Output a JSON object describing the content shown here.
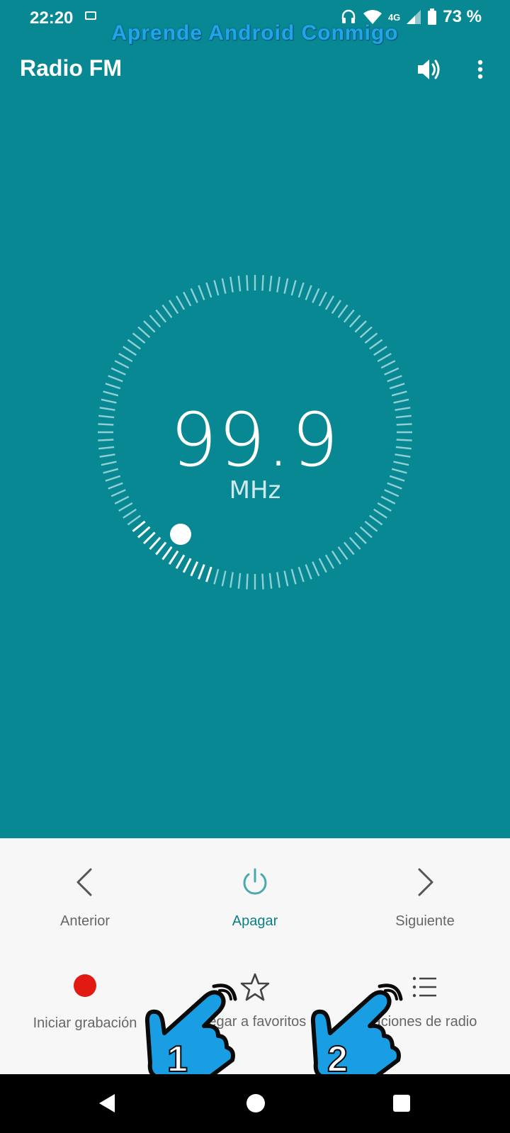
{
  "status_bar": {
    "time": "22:20",
    "network": "4G",
    "battery": "73 %",
    "icons": [
      "sim-icon",
      "headphones-icon",
      "wifi-icon",
      "signal-icon",
      "battery-icon"
    ]
  },
  "watermark": "Aprende Android Conmigo",
  "app_bar": {
    "title": "Radio FM",
    "icons": [
      "speaker-icon",
      "more-vert-icon"
    ]
  },
  "tuner": {
    "frequency": "99.9",
    "unit": "MHz"
  },
  "controls": {
    "row1": [
      {
        "label": "Anterior",
        "icon": "chevron-left-icon"
      },
      {
        "label": "Apagar",
        "icon": "power-icon"
      },
      {
        "label": "Siguiente",
        "icon": "chevron-right-icon"
      }
    ],
    "row2": [
      {
        "label": "Iniciar grabación",
        "icon": "record-icon"
      },
      {
        "label": "regar a favoritos",
        "icon": "star-icon"
      },
      {
        "label": "aciones de radio",
        "icon": "list-icon"
      }
    ]
  },
  "annotations": [
    "1",
    "2"
  ],
  "colors": {
    "background": "#088893",
    "panel": "#f7f7f7",
    "accent": "#0b7f88",
    "record": "#e21b12",
    "watermark": "#1ea6e8"
  },
  "nav_bar": {
    "icons": [
      "back-icon",
      "home-icon",
      "recents-icon"
    ]
  }
}
